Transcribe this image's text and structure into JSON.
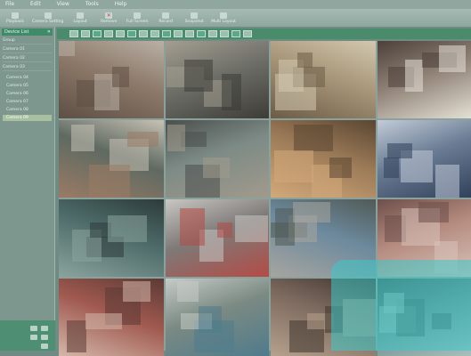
{
  "menu": {
    "items": [
      "File",
      "Edit",
      "View",
      "Tools",
      "Help"
    ]
  },
  "toolbar": {
    "buttons": [
      {
        "label": "Playback",
        "icon": "play-icon"
      },
      {
        "label": "Camera Setting",
        "icon": "camera-icon"
      },
      {
        "label": "Layout",
        "icon": "layout-icon"
      },
      {
        "label": "Remove",
        "icon": "close-icon"
      },
      {
        "label": "Full Screen",
        "icon": "fullscreen-icon"
      },
      {
        "label": "Record",
        "icon": "record-icon"
      },
      {
        "label": "Snapshot",
        "icon": "snapshot-icon"
      },
      {
        "label": "Multi Layout",
        "icon": "grid-icon"
      }
    ]
  },
  "sidebar": {
    "header": "Device List",
    "rows": [
      "Group",
      "Camera 01",
      "Camera 02",
      "Camera 03"
    ],
    "tree": [
      "Camera 04",
      "Camera 05",
      "Camera 06",
      "Camera 07",
      "Camera 08",
      "Camera 09"
    ]
  },
  "viewer_toolbar": {
    "button_count": 16
  },
  "cameras": [
    {
      "name": "camera-building-exterior",
      "colors": [
        "#8d7a6a",
        "#5e4f44",
        "#b9b1a6"
      ]
    },
    {
      "name": "camera-cafeteria",
      "colors": [
        "#70706a",
        "#3d3c37",
        "#a39e90"
      ]
    },
    {
      "name": "camera-warehouse-shelves",
      "colors": [
        "#a89779",
        "#6c5c47",
        "#d3c8b0"
      ]
    },
    {
      "name": "camera-train-station",
      "colors": [
        "#8e8074",
        "#e6e2d8",
        "#4c403a"
      ]
    },
    {
      "name": "camera-shopping-mall-escalator",
      "colors": [
        "#5f6a62",
        "#9a7b64",
        "#c7c1b4"
      ]
    },
    {
      "name": "camera-industrial-tower",
      "colors": [
        "#7d8b86",
        "#a29a8c",
        "#4a4f4c"
      ]
    },
    {
      "name": "camera-store-shelves",
      "colors": [
        "#9c7b58",
        "#d3a97a",
        "#5a4632"
      ]
    },
    {
      "name": "camera-office-crowd",
      "colors": [
        "#6b7d94",
        "#2f3f59",
        "#c2cbd8"
      ]
    },
    {
      "name": "camera-indoor-courtyard",
      "colors": [
        "#4e6c6a",
        "#8aa39d",
        "#2c3b3a"
      ]
    },
    {
      "name": "camera-train-platform",
      "colors": [
        "#7d7a78",
        "#b44b45",
        "#c9c7c3"
      ]
    },
    {
      "name": "camera-houses",
      "colors": [
        "#6d8a9e",
        "#a7a59f",
        "#505a56"
      ]
    },
    {
      "name": "camera-retail-aisle",
      "colors": [
        "#b58b7f",
        "#d8c3bb",
        "#6d4f4a"
      ]
    },
    {
      "name": "camera-checkout-counter",
      "colors": [
        "#a0594f",
        "#d3b7a9",
        "#5b3a35"
      ]
    },
    {
      "name": "camera-atrium-sign",
      "colors": [
        "#7b8a83",
        "#4f7b8c",
        "#c6cbc7"
      ]
    },
    {
      "name": "camera-shop-entrance",
      "colors": [
        "#7e6b60",
        "#b6a18d",
        "#3f342e"
      ]
    },
    {
      "name": "camera-corridor",
      "colors": [
        "#6c8a88",
        "#aac2c0",
        "#3f5453"
      ]
    }
  ]
}
